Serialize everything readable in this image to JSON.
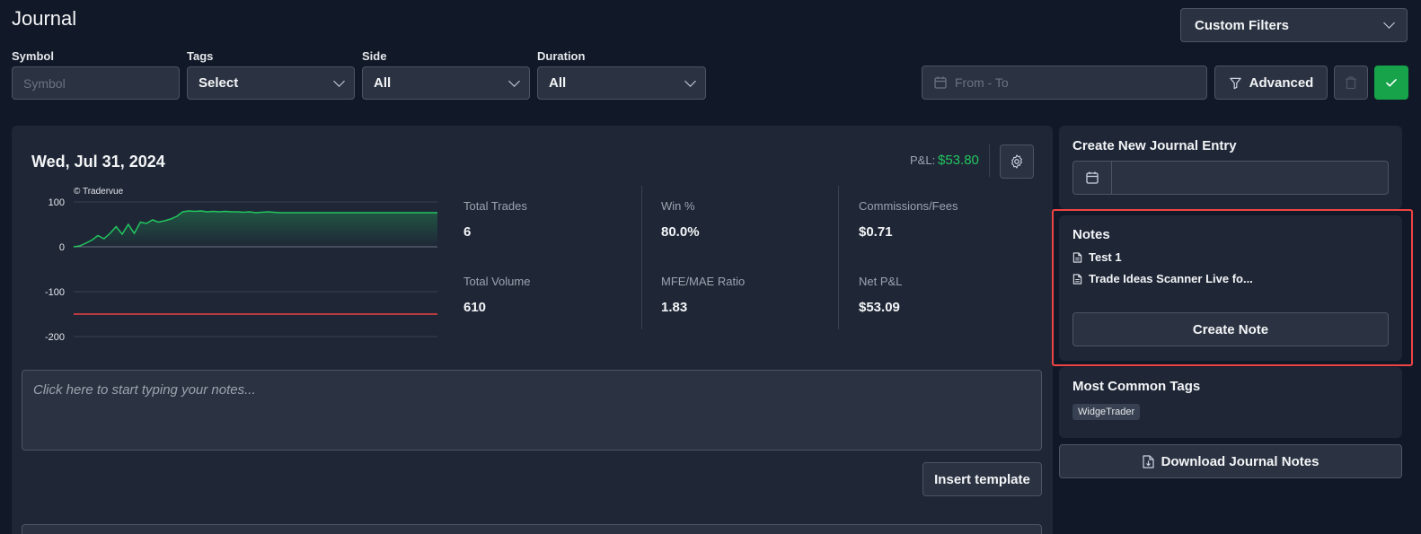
{
  "header": {
    "title": "Journal",
    "custom_filters_label": "Custom Filters"
  },
  "filters": {
    "symbol": {
      "label": "Symbol",
      "placeholder": "Symbol"
    },
    "tags": {
      "label": "Tags",
      "value": "Select"
    },
    "side": {
      "label": "Side",
      "value": "All"
    },
    "duration": {
      "label": "Duration",
      "value": "All"
    },
    "date_range_placeholder": "From - To",
    "advanced_label": "Advanced"
  },
  "day": {
    "date": "Wed, Jul 31, 2024",
    "pnl_label": "P&L:",
    "pnl_value": "$53.80",
    "chart_watermark": "© Tradervue",
    "stats": {
      "total_trades_label": "Total Trades",
      "total_trades": "6",
      "win_pct_label": "Win %",
      "win_pct": "80.0%",
      "commissions_label": "Commissions/Fees",
      "commissions": "$0.71",
      "total_volume_label": "Total Volume",
      "total_volume": "610",
      "mfe_mae_label": "MFE/MAE Ratio",
      "mfe_mae": "1.83",
      "net_pnl_label": "Net P&L",
      "net_pnl": "$53.09"
    },
    "notes_placeholder": "Click here to start typing your notes...",
    "insert_template_label": "Insert template"
  },
  "chart_data": {
    "type": "area",
    "ylim": [
      -200,
      100
    ],
    "yticks": [
      100,
      0,
      -100,
      -200
    ],
    "grid": true,
    "series": [
      {
        "color": "#22c55e",
        "values": [
          0,
          2,
          8,
          15,
          25,
          18,
          30,
          45,
          28,
          50,
          30,
          55,
          52,
          60,
          55,
          58,
          62,
          68,
          78,
          80,
          79,
          80,
          78,
          79,
          78,
          79,
          78,
          78,
          77,
          78,
          76,
          77,
          78,
          77,
          76,
          76,
          76,
          76,
          76,
          76,
          76,
          76,
          76,
          76,
          76,
          76,
          76,
          76,
          76,
          76,
          76,
          76,
          76,
          76,
          76,
          76,
          76,
          76,
          76,
          76,
          76
        ]
      },
      {
        "color": "#ef4444",
        "values": [
          -150,
          -150,
          -150,
          -150,
          -150,
          -150,
          -150,
          -150,
          -150,
          -150,
          -150,
          -150,
          -150,
          -150,
          -150,
          -150,
          -150,
          -150,
          -150,
          -150,
          -150,
          -150,
          -150,
          -150,
          -150,
          -150,
          -150,
          -150,
          -150,
          -150,
          -150,
          -150,
          -150,
          -150,
          -150,
          -150,
          -150,
          -150,
          -150,
          -150,
          -150,
          -150,
          -150,
          -150,
          -150,
          -150,
          -150,
          -150,
          -150,
          -150,
          -150,
          -150,
          -150,
          -150,
          -150,
          -150,
          -150,
          -150,
          -150,
          -150,
          -150
        ]
      }
    ]
  },
  "sidebar": {
    "new_entry_title": "Create New Journal Entry",
    "notes_title": "Notes",
    "notes": [
      "Test 1",
      "Trade Ideas Scanner Live fo..."
    ],
    "create_note_label": "Create Note",
    "tags_title": "Most Common Tags",
    "tags": [
      "WidgeTrader"
    ],
    "download_label": "Download Journal Notes"
  },
  "colors": {
    "positive": "#22c55e",
    "highlight": "#ef4444",
    "confirm": "#16a34a"
  }
}
